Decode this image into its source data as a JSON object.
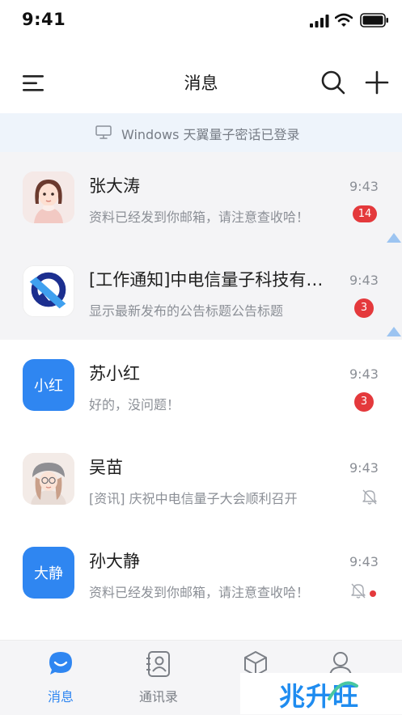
{
  "status_bar": {
    "time": "9:41"
  },
  "nav": {
    "title": "消息"
  },
  "login_banner": {
    "text": "Windows 天翼量子密话已登录"
  },
  "chats": [
    {
      "name": "张大涛",
      "preview": "资料已经发到你邮箱，请注意查收哈！",
      "time": "9:43",
      "badge": "14"
    },
    {
      "name": "[工作通知]中电信量子科技有限公司",
      "preview": "显示最新发布的公告标题公告标题",
      "time": "9:43",
      "badge": "3"
    },
    {
      "name": "苏小红",
      "avatar_text": "小红",
      "preview": "好的，没问题！",
      "time": "9:43",
      "badge": "3"
    },
    {
      "name": "吴苗",
      "preview": "[资讯] 庆祝中电信量子大会顺利召开",
      "time": "9:43"
    },
    {
      "name": "孙大静",
      "avatar_text": "大静",
      "preview": "资料已经发到你邮箱，请注意查收哈！",
      "time": "9:43"
    }
  ],
  "tabs": [
    {
      "label": "消息",
      "icon": "chat-bubble-icon",
      "active": true
    },
    {
      "label": "通讯录",
      "icon": "contacts-icon"
    },
    {
      "label": "",
      "icon": "cube-icon"
    },
    {
      "label": "",
      "icon": "profile-icon"
    }
  ],
  "watermark": {
    "text": "兆升旺"
  },
  "colors": {
    "accent": "#2f86f1",
    "badge": "#e4393c",
    "banner_bg": "#eef4fb",
    "pinned_bg": "#f4f4f6"
  }
}
